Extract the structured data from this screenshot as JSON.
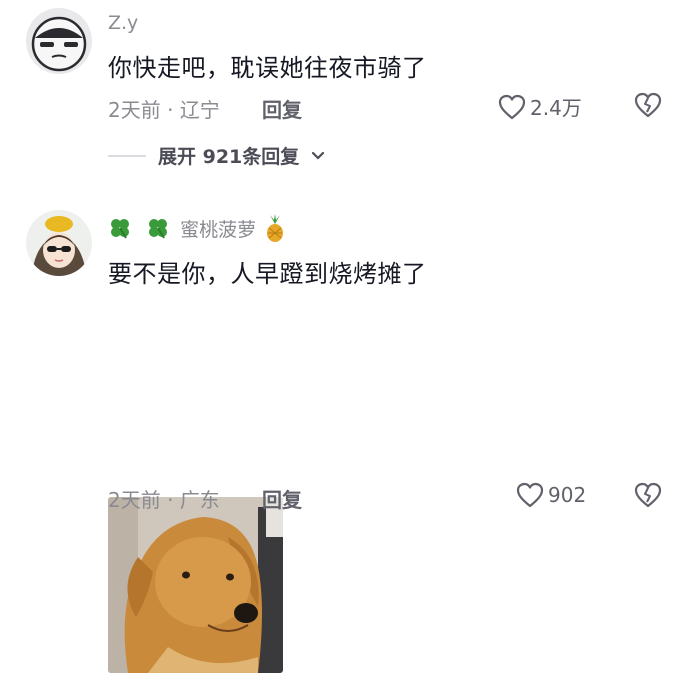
{
  "comments": [
    {
      "username": "Z.y",
      "text": "你快走吧，耽误她往夜市骑了",
      "time": "2天前",
      "separator": "·",
      "location": "辽宁",
      "reply_label": "回复",
      "like_count": "2.4万",
      "expand_label": "展开 921条回复",
      "avatar": "cartoon-face-avatar"
    },
    {
      "username": "蜜桃菠萝",
      "username_decorations": [
        "four-leaf-clover-emoji",
        "four-leaf-clover-emoji",
        "pineapple-emoji"
      ],
      "text": "要不是你，人早蹬到烧烤摊了",
      "time": "2天前",
      "separator": "·",
      "location": "广东",
      "reply_label": "回复",
      "like_count": "902",
      "image": "golden-dog-photo",
      "avatar": "girl-with-sunglasses-avatar"
    }
  ],
  "colors": {
    "primary_text": "#161823",
    "secondary_text": "#8a8b91",
    "accent_green": "#3a9b3a"
  }
}
